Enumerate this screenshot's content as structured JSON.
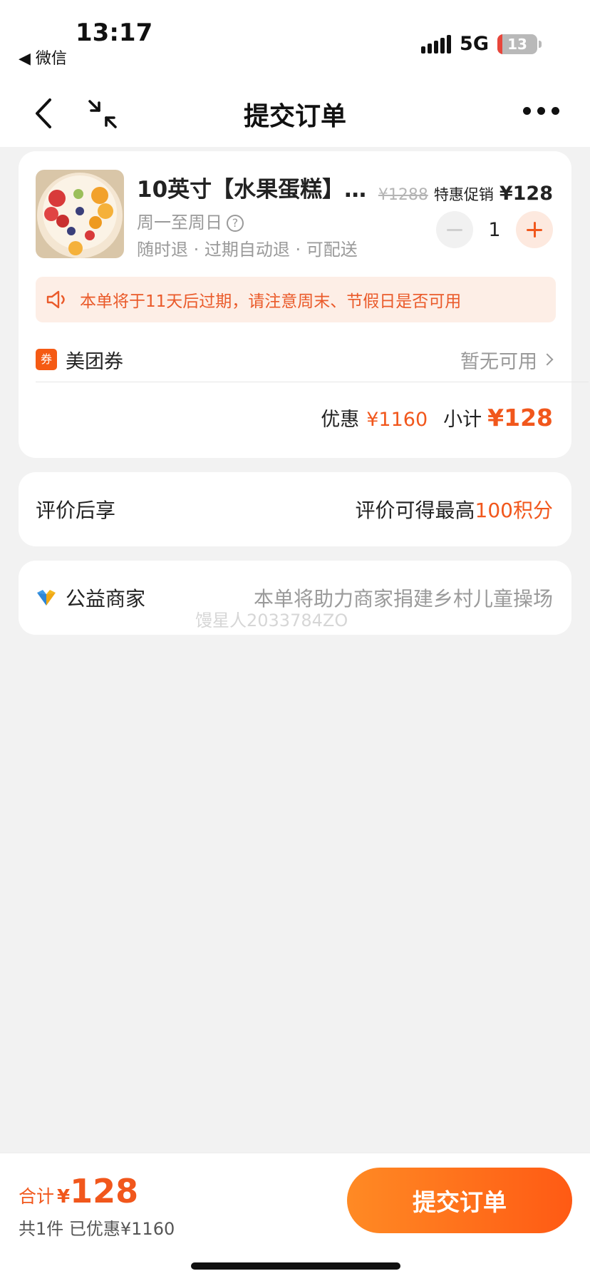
{
  "status_bar": {
    "time": "13:17",
    "back_app": "◀ 微信",
    "network": "5G",
    "battery_percent": 13,
    "battery_text": "13"
  },
  "nav": {
    "title": "提交订单",
    "back_icon": "chevron-left-icon",
    "shrink_icon": "shrink-icon",
    "more_icon": "more-dots-icon"
  },
  "product": {
    "title": "10英寸【水果蛋糕】…",
    "valid_days": "周一至周日",
    "policy": "随时退 · 过期自动退 · 可配送",
    "original_price": "¥1288",
    "promo_label": "特惠促销",
    "price": "¥128",
    "quantity": "1"
  },
  "notice": {
    "text": "本单将于11天后过期，请注意周末、节假日是否可用"
  },
  "coupon": {
    "tag": "券",
    "label": "美团券",
    "status": "暂无可用"
  },
  "subtotal": {
    "discount_label": "优惠",
    "discount_value": "¥1160",
    "subtotal_label": "小计",
    "subtotal_value": "¥128"
  },
  "review": {
    "label": "评价后享",
    "reward_prefix": "评价可得最高",
    "reward_value": "100积分"
  },
  "charity": {
    "label": "公益商家",
    "text": "本单将助力商家捐建乡村儿童操场",
    "watermark": "馒星人2033784ZO"
  },
  "bottom": {
    "total_label": "合计",
    "total_symbol": "¥",
    "total_value": "128",
    "count_text": "共1件  已优惠¥1160",
    "submit_label": "提交订单"
  },
  "colors": {
    "accent": "#f1571c",
    "notice_bg": "#fdeee6",
    "page_bg": "#f2f2f2"
  }
}
